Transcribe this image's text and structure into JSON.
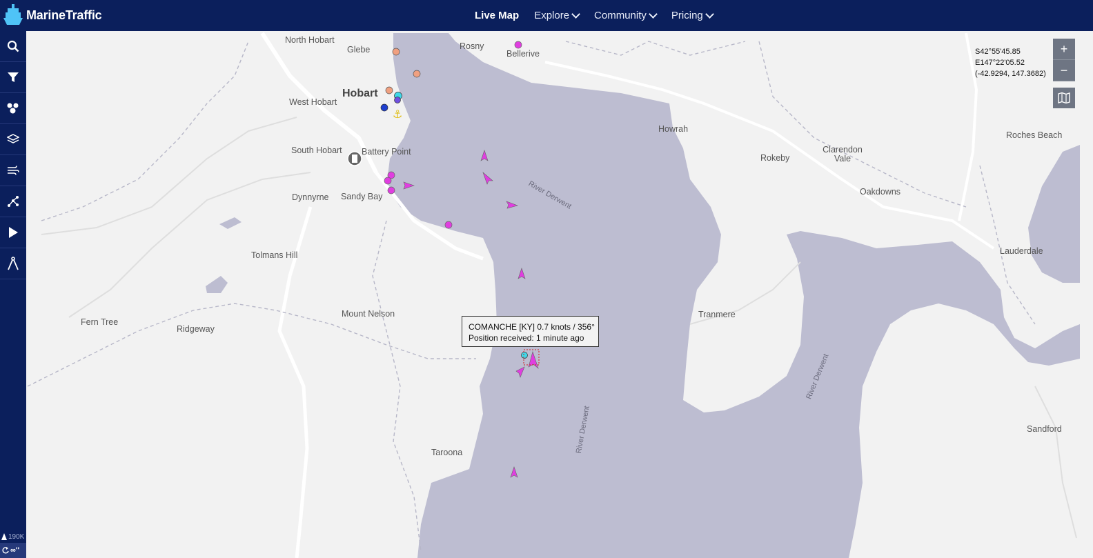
{
  "header": {
    "brand": "MarineTraffic",
    "nav": [
      {
        "label": "Live Map",
        "active": true,
        "dropdown": false
      },
      {
        "label": "Explore",
        "active": false,
        "dropdown": true
      },
      {
        "label": "Community",
        "active": false,
        "dropdown": true
      },
      {
        "label": "Pricing",
        "active": false,
        "dropdown": true
      }
    ]
  },
  "sidebar": {
    "tools": [
      "search-icon",
      "filter-icon",
      "fleet-icon",
      "layers-icon",
      "weather-icon",
      "route-icon",
      "play-icon",
      "measure-icon"
    ],
    "vessel_count": "190K",
    "loop_label": "∞''"
  },
  "map": {
    "coords": {
      "lat": "S42°55'45.85",
      "lon": "E147°22'05.52",
      "decimal": "(-42.9294, 147.3682)"
    },
    "zoom_in": "+",
    "zoom_out": "−",
    "places": {
      "north_hobart": "North Hobart",
      "glebe": "Glebe",
      "rosny": "Rosny",
      "bellerive": "Bellerive",
      "hobart": "Hobart",
      "west_hobart": "West Hobart",
      "south_hobart": "South Hobart",
      "battery_point": "Battery Point",
      "sandy_bay": "Sandy Bay",
      "dynnyrne": "Dynnyrne",
      "tolmans_hill": "Tolmans Hill",
      "mount_nelson": "Mount Nelson",
      "fern_tree": "Fern Tree",
      "ridgeway": "Ridgeway",
      "taroona": "Taroona",
      "howrah": "Howrah",
      "rokeby": "Rokeby",
      "clarendon_vale": "Clarendon Vale",
      "oakdowns": "Oakdowns",
      "roches_beach": "Roches Beach",
      "lauderdale": "Lauderdale",
      "tranmere": "Tranmere",
      "sandford": "Sandford"
    },
    "rivers": {
      "r1": "River Derwent",
      "r2": "River Derwent",
      "r3": "River Derwent"
    },
    "tooltip": {
      "line1": "COMANCHE [KY] 0.7 knots / 356°",
      "line2": "Position received: 1 minute ago"
    },
    "colors": {
      "water": "#bdbdd1",
      "land": "#f2f2f2",
      "vessel_pleasure": "#e03ee0",
      "vessel_passenger": "#1f3fcf",
      "vessel_tug": "#40d8e8",
      "vessel_other": "#f0a080",
      "nav_bg": "#0b1f5c"
    }
  }
}
